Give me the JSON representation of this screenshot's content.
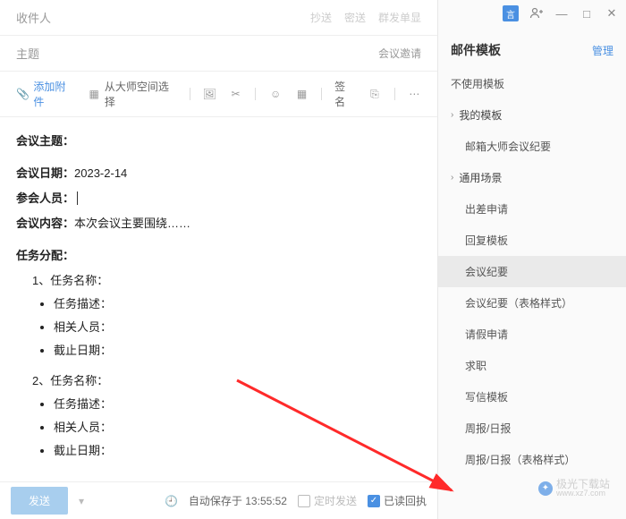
{
  "header": {
    "recipient_label": "收件人",
    "recipient_actions": [
      "抄送",
      "密送",
      "群发单显"
    ],
    "subject_label": "主题",
    "meeting_invite": "会议邀请"
  },
  "toolbar": {
    "attach": "添加附件",
    "from_master_space": "从大师空间选择",
    "sign": "签名"
  },
  "body": {
    "meeting_topic_label": "会议主题：",
    "meeting_date_label": "会议日期：",
    "meeting_date_value": "2023-2-14",
    "attendees_label": "参会人员：",
    "meeting_content_label": "会议内容：",
    "meeting_content_value": "本次会议主要围绕……",
    "task_alloc_label": "任务分配：",
    "task1_title": "1、任务名称：",
    "task2_title": "2、任务名称：",
    "bullet_task_desc": "任务描述：",
    "bullet_people": "相关人员：",
    "bullet_deadline": "截止日期："
  },
  "footer": {
    "send": "发送",
    "autosave": "自动保存于 13:55:52",
    "scheduled_send": "定时发送",
    "read_receipt": "已读回执"
  },
  "right": {
    "title": "邮件模板",
    "manage": "管理",
    "no_template": "不使用模板",
    "my_templates": "我的模板",
    "my_templates_items": [
      "邮箱大师会议纪要"
    ],
    "common_scenes": "通用场景",
    "common_items": [
      "出差申请",
      "回复模板",
      "会议纪要",
      "会议纪要（表格样式）",
      "请假申请",
      "求职",
      "写信模板",
      "周报/日报",
      "周报/日报（表格样式）"
    ]
  },
  "watermark": {
    "text": "极光下载站",
    "url": "www.xz7.com"
  }
}
